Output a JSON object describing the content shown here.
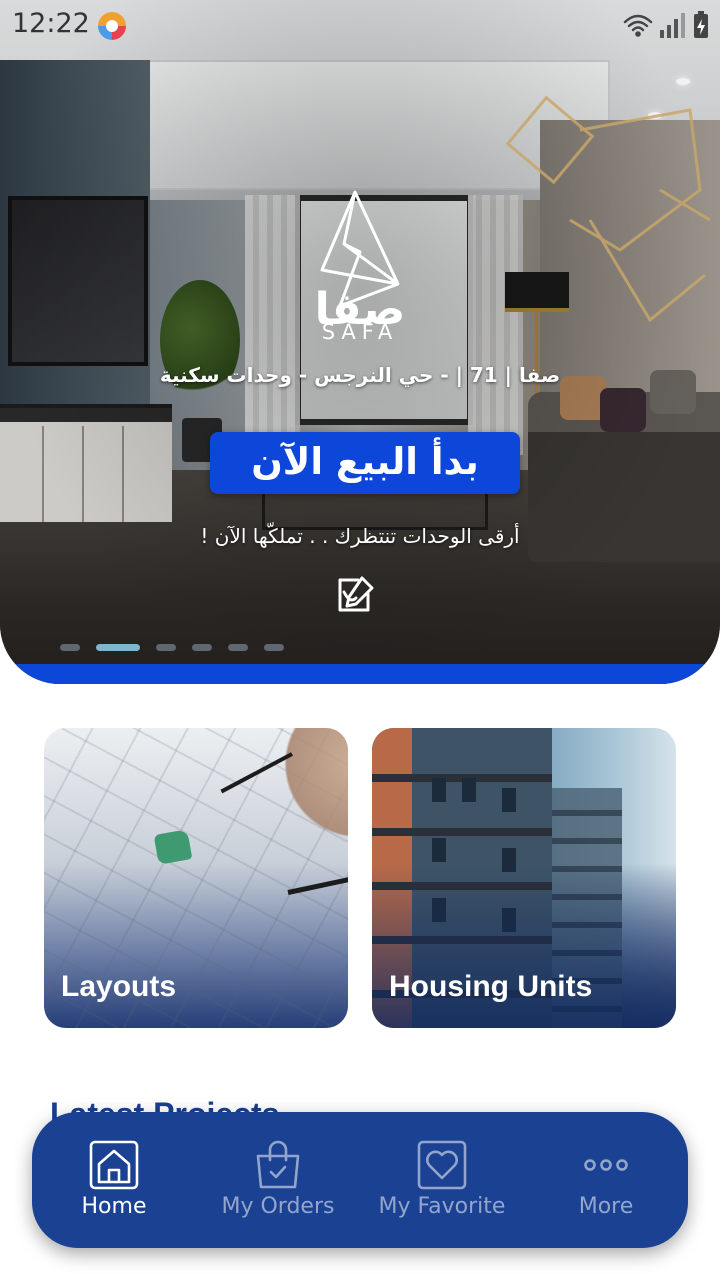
{
  "status_bar": {
    "time": "12:22",
    "icons": [
      "app-notification-icon",
      "wifi-icon",
      "signal-icon",
      "battery-icon"
    ]
  },
  "hero": {
    "brand_arabic": "صفا",
    "brand_latin": "SAFA",
    "subtitle": "صفا | 71 | - حي النرجس - وحدات سكنية",
    "cta_label": "بدأ البيع الآن",
    "tagline": "أرقى الوحدات تنتظرك . . تملكّها الآن !",
    "carousel_total": 6,
    "carousel_active_index": 1,
    "colors": {
      "accent": "#0d47d9",
      "indicator_active": "#7fb5d1",
      "indicator_inactive": "#5f6770"
    }
  },
  "categories": [
    {
      "label": "Layouts",
      "icon": "map-plan-image"
    },
    {
      "label": "Housing Units",
      "icon": "apartment-building-image"
    }
  ],
  "latest_projects": {
    "title": "Latest Projects"
  },
  "bottom_nav": {
    "items": [
      {
        "label": "Home",
        "icon": "home-icon",
        "active": true
      },
      {
        "label": "My Orders",
        "icon": "shopping-bag-icon",
        "active": false
      },
      {
        "label": "My Favorite",
        "icon": "heart-icon",
        "active": false
      },
      {
        "label": "More",
        "icon": "more-dots-icon",
        "active": false
      }
    ],
    "colors": {
      "background": "#1a4192",
      "active": "#ffffff",
      "inactive": "#93a5cd"
    }
  }
}
